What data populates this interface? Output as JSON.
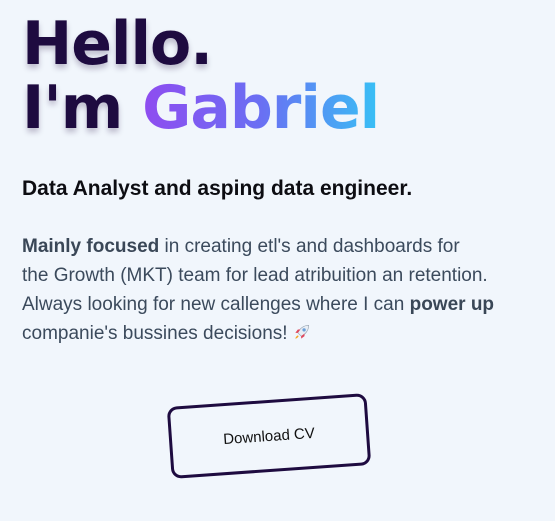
{
  "hero": {
    "greeting": "Hello.",
    "intro_prefix": "I'm ",
    "name": "Gabriel",
    "subtitle": "Data Analyst and asping data engineer.",
    "description": {
      "line1_bold": "Mainly focused",
      "line1_rest": " in creating etl's and dashboards for",
      "line2": "the Growth (MKT) team for lead atribuition an retention.",
      "line3_start": "Always looking for new callenges where I can ",
      "line3_bold": "power up",
      "line4": "companie's bussines decisions!",
      "emoji_icon": "rocket-icon"
    },
    "cv_button_label": "Download CV"
  },
  "colors": {
    "background": "#f1f6fc",
    "headline": "#1e0b40",
    "name_gradient": [
      "#8f4cf0",
      "#6a6ff3",
      "#38c0f5"
    ],
    "body_text": "#3b4a5c",
    "button_border": "#1e0b40"
  }
}
